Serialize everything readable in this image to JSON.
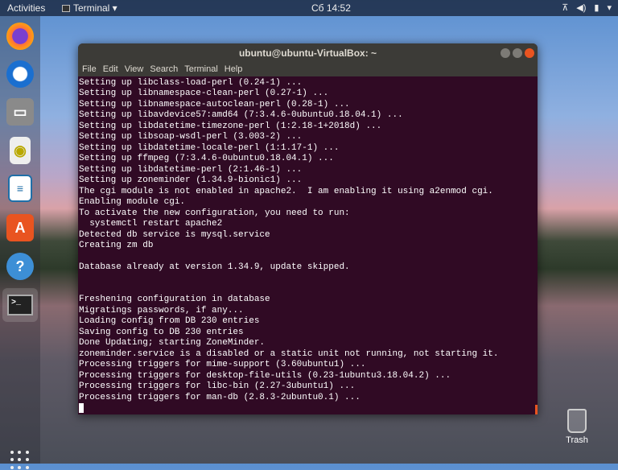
{
  "topbar": {
    "activities": "Activities",
    "app_menu": "Terminal ▾",
    "clock": "Сб 14:52",
    "tray": [
      "network-icon",
      "volume-icon",
      "battery-icon",
      "menu-arrow-icon"
    ]
  },
  "dock": {
    "items": [
      "Firefox",
      "Thunderbird",
      "Files",
      "Rhythmbox",
      "LibreOffice Writer",
      "Ubuntu Software",
      "Help",
      "Terminal"
    ]
  },
  "desktop": {
    "trash_label": "Trash"
  },
  "window": {
    "title": "ubuntu@ubuntu-VirtualBox: ~",
    "menu": [
      "File",
      "Edit",
      "View",
      "Search",
      "Terminal",
      "Help"
    ]
  },
  "terminal": {
    "lines": [
      "Setting up libclass-load-perl (0.24-1) ...",
      "Setting up libnamespace-clean-perl (0.27-1) ...",
      "Setting up libnamespace-autoclean-perl (0.28-1) ...",
      "Setting up libavdevice57:amd64 (7:3.4.6-0ubuntu0.18.04.1) ...",
      "Setting up libdatetime-timezone-perl (1:2.18-1+2018d) ...",
      "Setting up libsoap-wsdl-perl (3.003-2) ...",
      "Setting up libdatetime-locale-perl (1:1.17-1) ...",
      "Setting up ffmpeg (7:3.4.6-0ubuntu0.18.04.1) ...",
      "Setting up libdatetime-perl (2:1.46-1) ...",
      "Setting up zoneminder (1.34.9-bionic1) ...",
      "The cgi module is not enabled in apache2.  I am enabling it using a2enmod cgi.",
      "Enabling module cgi.",
      "To activate the new configuration, you need to run:",
      "  systemctl restart apache2",
      "Detected db service is mysql.service",
      "Creating zm db",
      "",
      "Database already at version 1.34.9, update skipped.",
      "",
      "",
      "Freshening configuration in database",
      "Migratings passwords, if any...",
      "Loading config from DB 230 entries",
      "Saving config to DB 230 entries",
      "Done Updating; starting ZoneMinder.",
      "zoneminder.service is a disabled or a static unit not running, not starting it.",
      "Processing triggers for mime-support (3.60ubuntu1) ...",
      "Processing triggers for desktop-file-utils (0.23-1ubuntu3.18.04.2) ...",
      "Processing triggers for libc-bin (2.27-3ubuntu1) ...",
      "Processing triggers for man-db (2.8.3-2ubuntu0.1) ..."
    ]
  },
  "colors": {
    "terminal_bg": "#300a24",
    "accent": "#e95420"
  }
}
